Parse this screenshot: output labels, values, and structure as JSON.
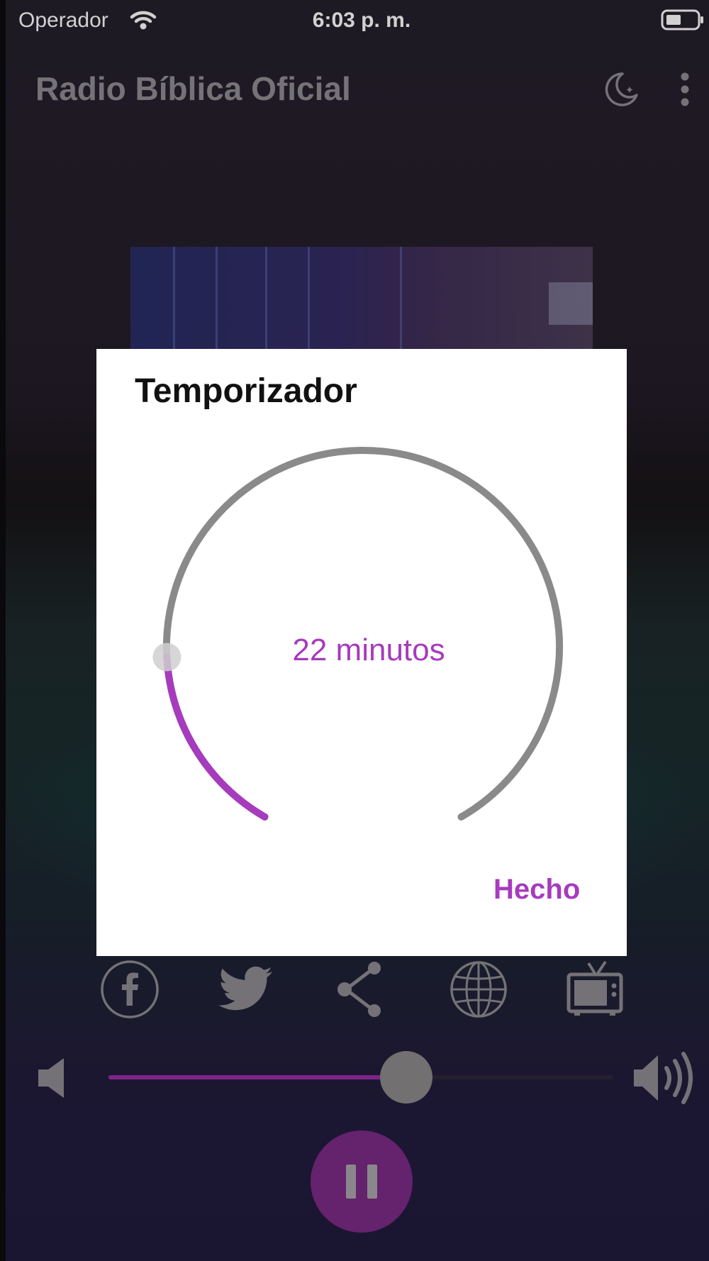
{
  "status_bar": {
    "carrier": "Operador",
    "time": "6:03 p. m."
  },
  "app_bar": {
    "title": "Radio Bíblica Oficial",
    "icons": [
      "moon-icon",
      "more-vertical-icon"
    ]
  },
  "social": {
    "icons": [
      "facebook-icon",
      "twitter-icon",
      "share-icon",
      "globe-icon",
      "tv-icon"
    ]
  },
  "volume": {
    "level": 0.59,
    "icons": [
      "volume-low-icon",
      "volume-high-icon"
    ]
  },
  "player": {
    "state_icon": "pause-icon"
  },
  "timer_dialog": {
    "title": "Temporizador",
    "value_label": "22 minutos",
    "minutes": 22,
    "fraction": 0.19,
    "done_label": "Hecho"
  },
  "colors": {
    "accent": "#a63bbd",
    "dial_track": "#8a8a8a",
    "dial_fill": "#a63bbd",
    "title_text": "#8f8c93",
    "player_button": "#7c2a85"
  }
}
